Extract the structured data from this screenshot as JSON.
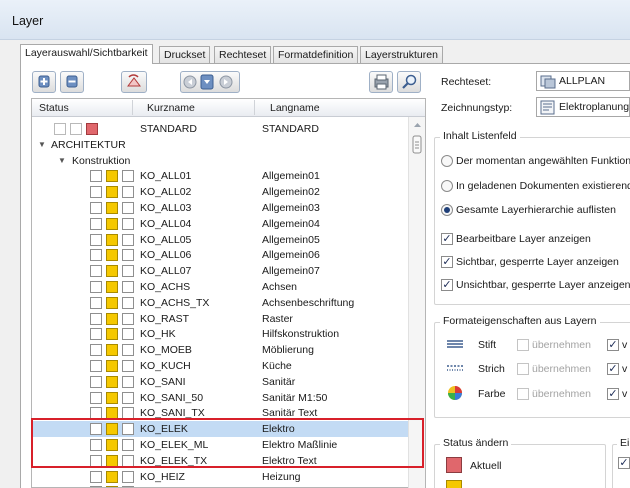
{
  "window": {
    "title": "Layer"
  },
  "tabs": [
    {
      "label": "Layerauswahl/Sichtbarkeit",
      "active": true
    },
    {
      "label": "Druckset"
    },
    {
      "label": "Rechteset"
    },
    {
      "label": "Formatdefinition"
    },
    {
      "label": "Layerstrukturen"
    }
  ],
  "list": {
    "headers": {
      "status": "Status",
      "kurzname": "Kurzname",
      "langname": "Langname"
    },
    "rows": [
      {
        "k": "STANDARD",
        "l": "STANDARD",
        "type": "root"
      },
      {
        "k": "ARCHITEKTUR",
        "l": "",
        "type": "group1"
      },
      {
        "k": "Konstruktion",
        "l": "",
        "type": "group2"
      },
      {
        "k": "KO_ALL01",
        "l": "Allgemein01"
      },
      {
        "k": "KO_ALL02",
        "l": "Allgemein02"
      },
      {
        "k": "KO_ALL03",
        "l": "Allgemein03"
      },
      {
        "k": "KO_ALL04",
        "l": "Allgemein04"
      },
      {
        "k": "KO_ALL05",
        "l": "Allgemein05"
      },
      {
        "k": "KO_ALL06",
        "l": "Allgemein06"
      },
      {
        "k": "KO_ALL07",
        "l": "Allgemein07"
      },
      {
        "k": "KO_ACHS",
        "l": "Achsen"
      },
      {
        "k": "KO_ACHS_TX",
        "l": "Achsenbeschriftung"
      },
      {
        "k": "KO_RAST",
        "l": "Raster"
      },
      {
        "k": "KO_HK",
        "l": "Hilfskonstruktion"
      },
      {
        "k": "KO_MOEB",
        "l": "Möblierung"
      },
      {
        "k": "KO_KUCH",
        "l": "Küche"
      },
      {
        "k": "KO_SANI",
        "l": "Sanitär"
      },
      {
        "k": "KO_SANI_50",
        "l": "Sanitär M1:50"
      },
      {
        "k": "KO_SANI_TX",
        "l": "Sanitär Text"
      },
      {
        "k": "KO_ELEK",
        "l": "Elektro",
        "selected": true
      },
      {
        "k": "KO_ELEK_ML",
        "l": "Elektro Maßlinie"
      },
      {
        "k": "KO_ELEK_TX",
        "l": "Elektro Text"
      },
      {
        "k": "KO_HEIZ",
        "l": "Heizung"
      },
      {
        "k": "KO_KLIM",
        "l": "K"
      }
    ]
  },
  "right": {
    "rechteset_label": "Rechteset:",
    "rechteset_value": "ALLPLAN",
    "zeichnungstyp_label": "Zeichnungstyp:",
    "zeichnungstyp_value": "Elektroplanung",
    "inhalt_title": "Inhalt Listenfeld",
    "radio_1": "Der momentan angewählten Funktion",
    "radio_2": "In geladenen Dokumenten existierend",
    "radio_3": "Gesamte Layerhierarchie auflisten",
    "check_1": "Bearbeitbare Layer anzeigen",
    "check_2": "Sichtbar, gesperrte Layer anzeigen",
    "check_3": "Unsichtbar, gesperrte Layer anzeigen",
    "format_title": "Formateigenschaften aus Layern",
    "stift": "Stift",
    "strich": "Strich",
    "farbe": "Farbe",
    "uebernehmen": "übernehmen",
    "v": "v",
    "status_title": "Status ändern",
    "aktuell": "Aktuell",
    "ei": "Ei"
  },
  "colors": {
    "selection": "#c3dbf4",
    "highlight_border": "#d8202a",
    "current_layer": "#e0676c",
    "editable_layer": "#f5c800"
  }
}
